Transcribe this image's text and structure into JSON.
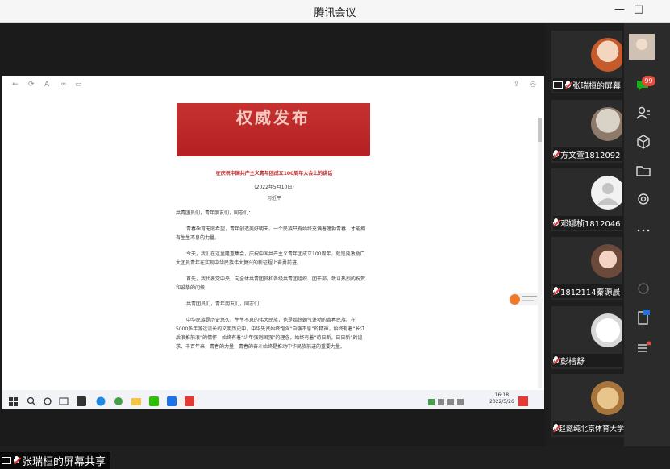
{
  "window": {
    "title": "腾讯会议"
  },
  "share": {
    "label": "张瑞桓的屏幕共享"
  },
  "document": {
    "banner": "权威发布",
    "heading": "在庆祝中国共产主义青年团成立100周年大会上的讲话",
    "date": "（2022年5月10日）",
    "author": "习近平",
    "paragraphs": [
      "共青团员们，青年朋友们，同志们：",
      "青春孕育无限希望，青年创造美好明天。一个民族只有始终充满着蓬勃青春，才能拥有生生不息的力量。",
      "今天，我们在这里隆重集会，庆祝中国共产主义青年团成立100周年，就是要激励广大团员青年在实现中华民族伟大复兴的新征程上奋勇前进。",
      "首先，我代表党中央，向全体共青团员和各级共青团组织、团干部，致以热烈的祝贺和诚挚的问候！",
      "共青团员们，青年朋友们，同志们！",
      "中华民族是历史悠久、生生不息的伟大民族，也是始终朝气蓬勃的青春民族。在5000多年源远流长的文明历史中，中华先贤始终饱含“自强不息”的精神，始终有着“长江后浪推前浪”的情怀，始终有着“少年强则国强”的理念，始终有着“苟日新，日日新”的追求，千百年来，青春的力量，青春的奋斗始终是推动中华民族前进的重要力量。"
    ]
  },
  "taskbar": {
    "time": "16:18",
    "date": "2022/5/26"
  },
  "participants": [
    {
      "name": "张瑞桓的屏幕",
      "muted": true
    },
    {
      "name": "方文萱1812092",
      "muted": true
    },
    {
      "name": "邓娜桢1812046",
      "muted": true
    },
    {
      "name": "1812114秦源晨",
      "muted": true
    },
    {
      "name": "彭楷舒",
      "muted": true
    },
    {
      "name": "赵懿纯北京体育大学",
      "muted": true
    }
  ],
  "sidebar": {
    "chat_badge": "99",
    "icons": [
      "avatar-icon",
      "chat-icon",
      "members-icon",
      "apps-icon",
      "folder-icon",
      "settings-icon",
      "more-icon",
      "link-icon",
      "document-icon",
      "menu-icon"
    ]
  },
  "colors": {
    "banner_red": "#c63130",
    "badge_red": "#e74c3c",
    "chat_green": "#1aad19"
  }
}
